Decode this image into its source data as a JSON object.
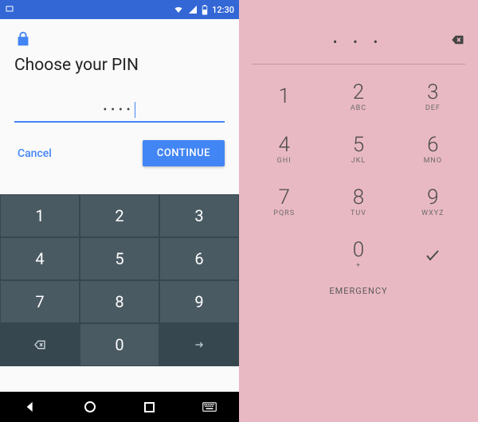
{
  "left": {
    "statusbar": {
      "time": "12:30"
    },
    "title": "Choose your PIN",
    "pin_masked": "••••",
    "cancel_label": "Cancel",
    "continue_label": "CONTINUE",
    "keypad": {
      "r0": [
        "1",
        "2",
        "3"
      ],
      "r1": [
        "4",
        "5",
        "6"
      ],
      "r2": [
        "7",
        "8",
        "9"
      ],
      "r3_zero": "0"
    }
  },
  "right": {
    "entry_masked": "• • •",
    "keys": [
      {
        "n": "1",
        "s": ""
      },
      {
        "n": "2",
        "s": "ABC"
      },
      {
        "n": "3",
        "s": "DEF"
      },
      {
        "n": "4",
        "s": "GHI"
      },
      {
        "n": "5",
        "s": "JKL"
      },
      {
        "n": "6",
        "s": "MNO"
      },
      {
        "n": "7",
        "s": "PQRS"
      },
      {
        "n": "8",
        "s": "TUV"
      },
      {
        "n": "9",
        "s": "WXYZ"
      },
      {
        "n": "",
        "s": ""
      },
      {
        "n": "0",
        "s": "+"
      },
      {
        "n": "",
        "s": ""
      }
    ],
    "emergency_label": "EMERGENCY"
  }
}
